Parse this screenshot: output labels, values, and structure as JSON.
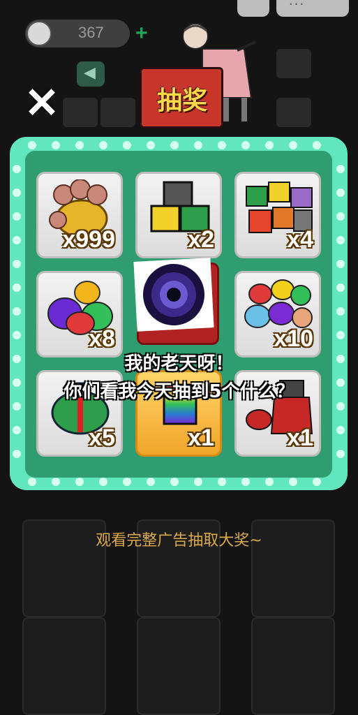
{
  "header": {
    "coin_count": "367",
    "coin_plus": "+",
    "more_label": "···",
    "close_label": "✕",
    "sign_label": "抽奖"
  },
  "board": {
    "cells": [
      {
        "qty": "x999",
        "icon": "coin-bag-icon",
        "selected": false
      },
      {
        "qty": "x2",
        "icon": "cat-heads-icon",
        "selected": false
      },
      {
        "qty": "x4",
        "icon": "cat-pile-icon",
        "selected": false
      },
      {
        "qty": "x8",
        "icon": "gift-bags-icon",
        "selected": false
      },
      {
        "qty": "x10",
        "icon": "gift-bag-pile-icon",
        "selected": false
      },
      {
        "qty": "x5",
        "icon": "green-gift-bag-icon",
        "selected": false
      },
      {
        "qty": "x1",
        "icon": "rainbow-cat-icon",
        "selected": true
      },
      {
        "qty": "x1",
        "icon": "red-outfit-icon",
        "selected": false
      }
    ],
    "center_icon": "black-hole-icon"
  },
  "captions": {
    "line1": "我的老天呀！",
    "line2": "你们看我今天抽到5个什么？"
  },
  "footer": {
    "ad_text": "观看完整广告抽取大奖~"
  },
  "colors": {
    "board_frame": "#61e6bd",
    "board_inner": "#2f9d70",
    "selected_cell": "#f0a52a",
    "sign_red": "#c8362b",
    "sign_text": "#ffd84a",
    "ad_text": "#d9a94a"
  }
}
